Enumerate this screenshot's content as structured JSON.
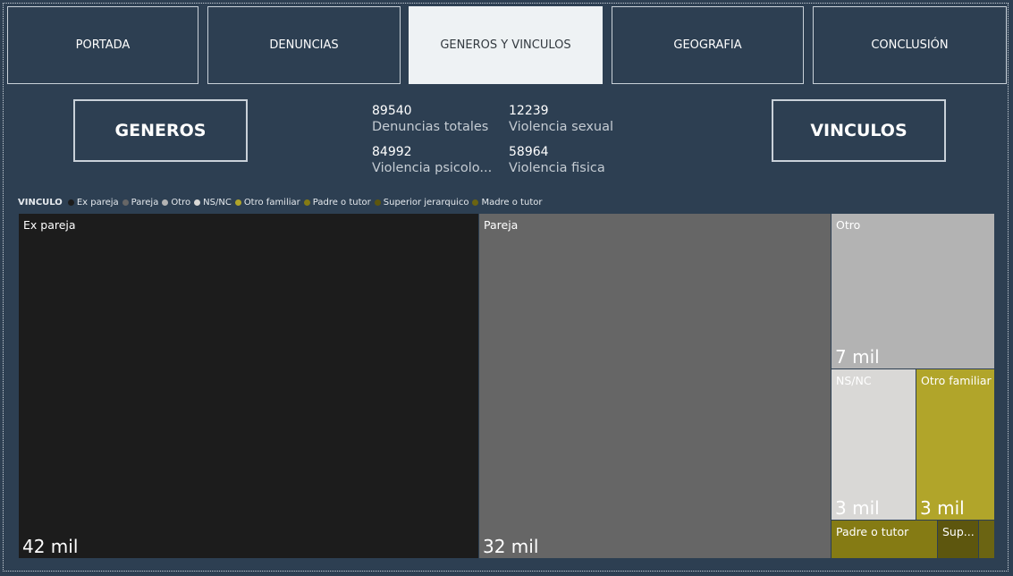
{
  "nav": {
    "tabs": [
      {
        "label": "PORTADA"
      },
      {
        "label": "DENUNCIAS"
      },
      {
        "label": "GENEROS Y VINCULOS"
      },
      {
        "label": "GEOGRAFIA"
      },
      {
        "label": "CONCLUSIÓN"
      }
    ],
    "active": "GENEROS Y VINCULOS"
  },
  "buttons": {
    "generos": "GENEROS",
    "vinculos": "VINCULOS"
  },
  "kpis": [
    {
      "value": "89540",
      "label": "Denuncias totales"
    },
    {
      "value": "12239",
      "label": "Violencia sexual"
    },
    {
      "value": "84992",
      "label": "Violencia psicolo..."
    },
    {
      "value": "58964",
      "label": "Violencia fisica"
    }
  ],
  "legend": {
    "title": "VINCULO",
    "items": [
      {
        "label": "Ex pareja",
        "color": "#1c1c1c"
      },
      {
        "label": "Pareja",
        "color": "#666666"
      },
      {
        "label": "Otro",
        "color": "#b3b3b3"
      },
      {
        "label": "NS/NC",
        "color": "#d9d8d6"
      },
      {
        "label": "Otro familiar",
        "color": "#b1a52a"
      },
      {
        "label": "Padre o tutor",
        "color": "#857b14"
      },
      {
        "label": "Superior jerarquico",
        "color": "#5d560e"
      },
      {
        "label": "Madre o tutor",
        "color": "#6b6412"
      }
    ]
  },
  "chart_data": {
    "type": "treemap",
    "series": [
      {
        "name": "Ex pareja",
        "value_label": "42 mil",
        "color": "#1c1c1c"
      },
      {
        "name": "Pareja",
        "value_label": "32 mil",
        "color": "#666666"
      },
      {
        "name": "Otro",
        "value_label": "7 mil",
        "color": "#b3b3b3"
      },
      {
        "name": "NS/NC",
        "value_label": "3 mil",
        "color": "#d9d8d6"
      },
      {
        "name": "Otro familiar",
        "value_label": "3 mil",
        "color": "#b1a52a"
      },
      {
        "name": "Padre o tutor",
        "value_label": "",
        "color": "#857b14"
      },
      {
        "name": "Sup...",
        "value_label": "",
        "color": "#5d560e"
      },
      {
        "name": "",
        "value_label": "",
        "color": "#6b6412"
      }
    ]
  }
}
